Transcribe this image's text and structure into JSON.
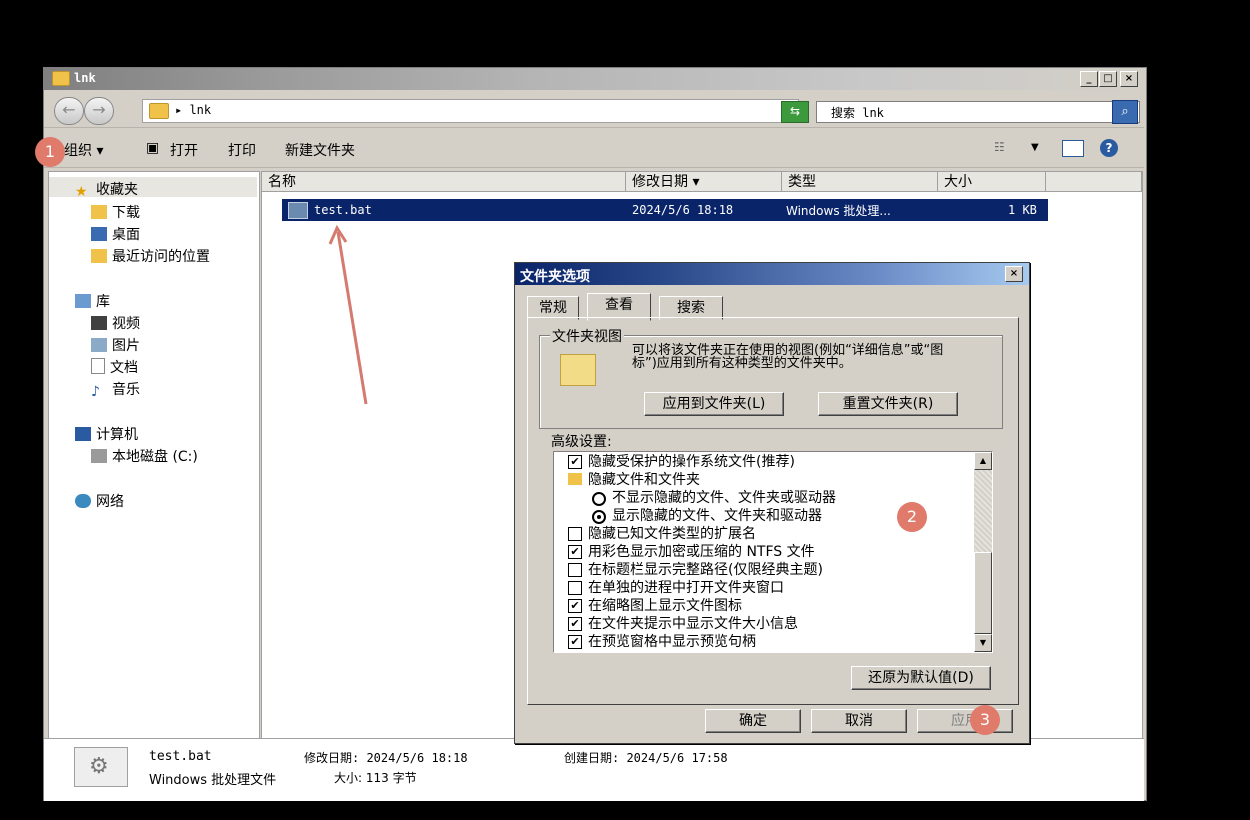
{
  "window": {
    "title": "lnk",
    "caption_min": "_",
    "caption_max": "□",
    "caption_close": "×",
    "address_path": "▸ lnk",
    "search_placeholder": "搜索 lnk"
  },
  "toolbar": {
    "organize": "组织 ▾",
    "open": "打开",
    "print": "打印",
    "new_folder": "新建文件夹"
  },
  "sidebar": {
    "favorites": "收藏夹",
    "downloads": "下载",
    "desktop": "桌面",
    "recent": "最近访问的位置",
    "libraries": "库",
    "videos": "视频",
    "pictures": "图片",
    "documents": "文档",
    "music": "音乐",
    "computer": "计算机",
    "local_disk": "本地磁盘 (C:)",
    "network": "网络"
  },
  "columns": {
    "name": "名称",
    "date": "修改日期 ▾",
    "type": "类型",
    "size": "大小"
  },
  "file": {
    "name": "test.bat",
    "date": "2024/5/6 18:18",
    "type": "Windows 批处理...",
    "size": "1 KB"
  },
  "details": {
    "name": "test.bat",
    "modified": "修改日期: 2024/5/6 18:18",
    "created": "创建日期: 2024/5/6 17:58",
    "type": "Windows 批处理文件",
    "size": "大小: 113 字节"
  },
  "dialog": {
    "title": "文件夹选项",
    "close": "×",
    "tabs": [
      "常规",
      "查看",
      "搜索"
    ],
    "folder_view_group": "文件夹视图",
    "folder_view_desc": "可以将该文件夹正在使用的视图(例如“详细信息”或“图标”)应用到所有这种类型的文件夹中。",
    "apply_to_folders": "应用到文件夹(L)",
    "reset_folders": "重置文件夹(R)",
    "advanced_label": "高级设置:",
    "options": [
      {
        "label": "隐藏受保护的操作系统文件(推荐)",
        "kind": "check",
        "checked": true
      },
      {
        "label": "隐藏文件和文件夹",
        "kind": "folder",
        "checked": false
      },
      {
        "label": "不显示隐藏的文件、文件夹或驱动器",
        "kind": "radio",
        "checked": false
      },
      {
        "label": "显示隐藏的文件、文件夹和驱动器",
        "kind": "radio",
        "checked": true
      },
      {
        "label": "隐藏已知文件类型的扩展名",
        "kind": "check",
        "checked": false
      },
      {
        "label": "用彩色显示加密或压缩的 NTFS 文件",
        "kind": "check",
        "checked": true
      },
      {
        "label": "在标题栏显示完整路径(仅限经典主题)",
        "kind": "check",
        "checked": false
      },
      {
        "label": "在单独的进程中打开文件夹窗口",
        "kind": "check",
        "checked": false
      },
      {
        "label": "在缩略图上显示文件图标",
        "kind": "check",
        "checked": true
      },
      {
        "label": "在文件夹提示中显示文件大小信息",
        "kind": "check",
        "checked": true
      },
      {
        "label": "在预览窗格中显示预览句柄",
        "kind": "check",
        "checked": true
      }
    ],
    "restore_defaults": "还原为默认值(D)",
    "ok": "确定",
    "cancel": "取消",
    "apply": "应用"
  },
  "annotations": {
    "badge1": "1",
    "badge2": "2",
    "badge3": "3",
    "accent": "#e07a6a"
  }
}
